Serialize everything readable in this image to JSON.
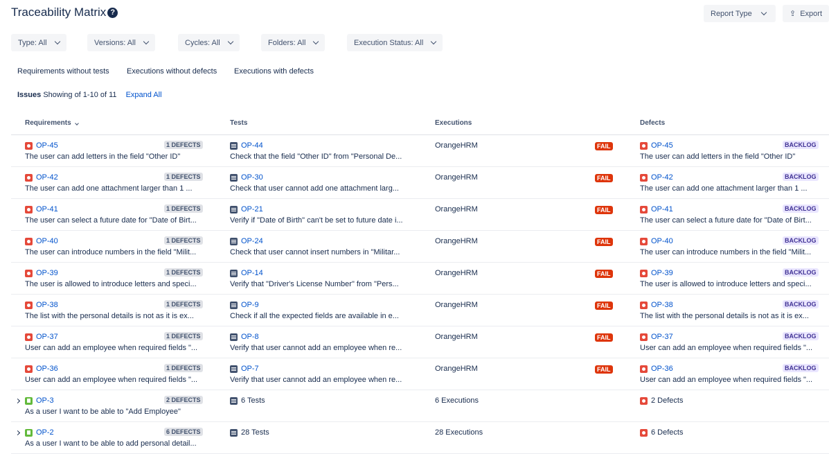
{
  "header": {
    "title": "Traceability Matrix",
    "report_type": "Report Type",
    "export": "Export"
  },
  "filters": [
    "Type: All",
    "Versions: All",
    "Cycles: All",
    "Folders: All",
    "Execution Status: All"
  ],
  "quick_filters": [
    "Requirements without tests",
    "Executions without defects",
    "Executions with defects"
  ],
  "summary": {
    "label": "Issues",
    "showing": "Showing of 1-10 of 11",
    "expand": "Expand All"
  },
  "columns": [
    "Requirements",
    "Tests",
    "Executions",
    "Defects"
  ],
  "rows": [
    {
      "req_key": "OP-45",
      "req_type": "bug",
      "req_summary": "The user can add letters in the field \"Other ID\"",
      "defects_badge": "1 DEFECTS",
      "test_key": "OP-44",
      "test_summary": "Check that the field \"Other ID\" from \"Personal De...",
      "execution": "OrangeHRM",
      "status": "FAIL",
      "defect_key": "OP-45",
      "defect_summary": "The user can add letters in the field \"Other ID\"",
      "defect_status": "BACKLOG"
    },
    {
      "req_key": "OP-42",
      "req_type": "bug",
      "req_summary": "The user can add one attachment larger than 1 ...",
      "defects_badge": "1 DEFECTS",
      "test_key": "OP-30",
      "test_summary": "Check that user cannot add one attachment larg...",
      "execution": "OrangeHRM",
      "status": "FAIL",
      "defect_key": "OP-42",
      "defect_summary": "The user can add one attachment larger than 1 ...",
      "defect_status": "BACKLOG"
    },
    {
      "req_key": "OP-41",
      "req_type": "bug",
      "req_summary": "The user can select a future date for \"Date of Birt...",
      "defects_badge": "1 DEFECTS",
      "test_key": "OP-21",
      "test_summary": "Verify if \"Date of Birth\" can't be set to future date i...",
      "execution": "OrangeHRM",
      "status": "FAIL",
      "defect_key": "OP-41",
      "defect_summary": "The user can select a future date for \"Date of Birt...",
      "defect_status": "BACKLOG"
    },
    {
      "req_key": "OP-40",
      "req_type": "bug",
      "req_summary": "The user can introduce numbers in the field \"Milit...",
      "defects_badge": "1 DEFECTS",
      "test_key": "OP-24",
      "test_summary": "Check that user cannot insert numbers in \"Militar...",
      "execution": "OrangeHRM",
      "status": "FAIL",
      "defect_key": "OP-40",
      "defect_summary": "The user can introduce numbers in the field \"Milit...",
      "defect_status": "BACKLOG"
    },
    {
      "req_key": "OP-39",
      "req_type": "bug",
      "req_summary": "The user is allowed to introduce letters and speci...",
      "defects_badge": "1 DEFECTS",
      "test_key": "OP-14",
      "test_summary": "Verify that \"Driver's License Number\" from \"Pers...",
      "execution": "OrangeHRM",
      "status": "FAIL",
      "defect_key": "OP-39",
      "defect_summary": "The user is allowed to introduce letters and speci...",
      "defect_status": "BACKLOG"
    },
    {
      "req_key": "OP-38",
      "req_type": "bug",
      "req_summary": "The list with the personal details is not as it is ex...",
      "defects_badge": "1 DEFECTS",
      "test_key": "OP-9",
      "test_summary": "Check if all the expected fields are available in e...",
      "execution": "OrangeHRM",
      "status": "FAIL",
      "defect_key": "OP-38",
      "defect_summary": "The list with the personal details is not as it is ex...",
      "defect_status": "BACKLOG"
    },
    {
      "req_key": "OP-37",
      "req_type": "bug",
      "req_summary": "User can add an employee when required fields \"...",
      "defects_badge": "1 DEFECTS",
      "test_key": "OP-8",
      "test_summary": "Verify that user cannot add an employee when re...",
      "execution": "OrangeHRM",
      "status": "FAIL",
      "defect_key": "OP-37",
      "defect_summary": "User can add an employee when required fields \"...",
      "defect_status": "BACKLOG"
    },
    {
      "req_key": "OP-36",
      "req_type": "bug",
      "req_summary": "User can add an employee when required fields \"...",
      "defects_badge": "1 DEFECTS",
      "test_key": "OP-7",
      "test_summary": "Verify that user cannot add an employee when re...",
      "execution": "OrangeHRM",
      "status": "FAIL",
      "defect_key": "OP-36",
      "defect_summary": "User can add an employee when required fields \"...",
      "defect_status": "BACKLOG"
    },
    {
      "req_key": "OP-3",
      "req_type": "story",
      "req_summary": "As a user I want to be able to \"Add Employee\"",
      "defects_badge": "2 DEFECTS",
      "tests_count": "6 Tests",
      "executions_count": "6 Executions",
      "defects_count": "2 Defects"
    },
    {
      "req_key": "OP-2",
      "req_type": "story",
      "req_summary": "As a user I want to be able to add personal detail...",
      "defects_badge": "6 DEFECTS",
      "tests_count": "28 Tests",
      "executions_count": "28 Executions",
      "defects_count": "6 Defects"
    }
  ]
}
